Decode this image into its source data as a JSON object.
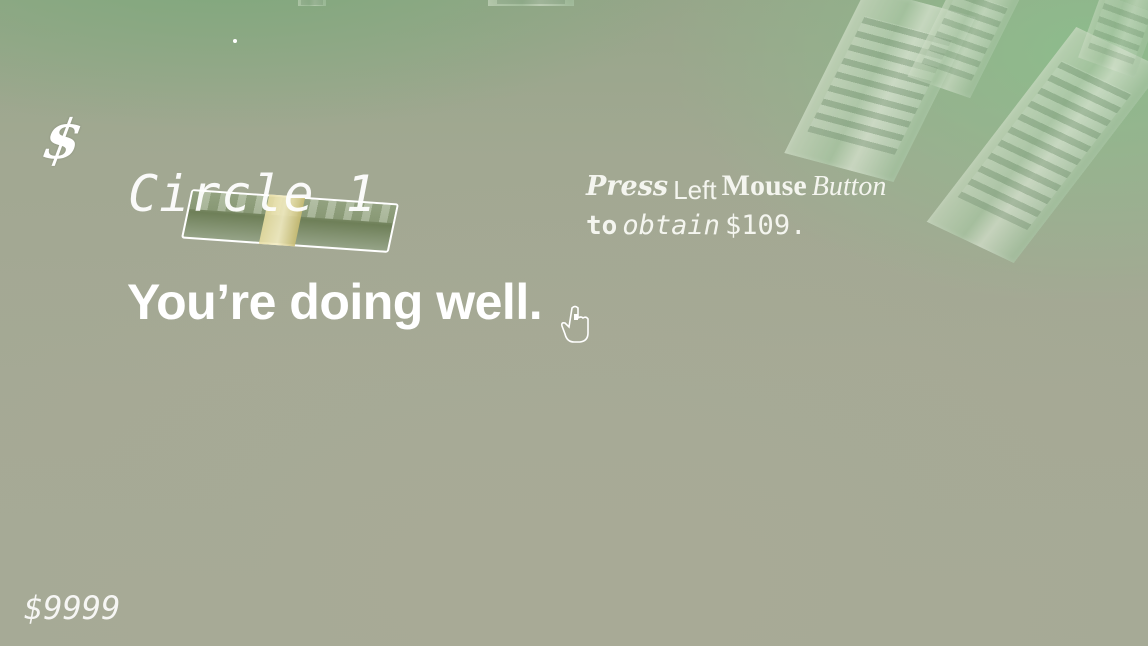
{
  "hud": {
    "currency_icon": "dollar-sign-icon",
    "currency_symbol": "$",
    "level_label": "Circle 1",
    "status_message": "You’re doing well.",
    "money": "$9999"
  },
  "prompt": {
    "word_press": "Press",
    "word_left": "Left",
    "word_mouse": "Mouse",
    "word_button": "Button",
    "word_to": "to",
    "word_obtain": "obtain",
    "amount": "$109."
  },
  "scene": {
    "cursor_icon": "hand-pointer-icon",
    "object": "cash-stack",
    "accent": "#ffffff",
    "background": "#a5a995"
  }
}
